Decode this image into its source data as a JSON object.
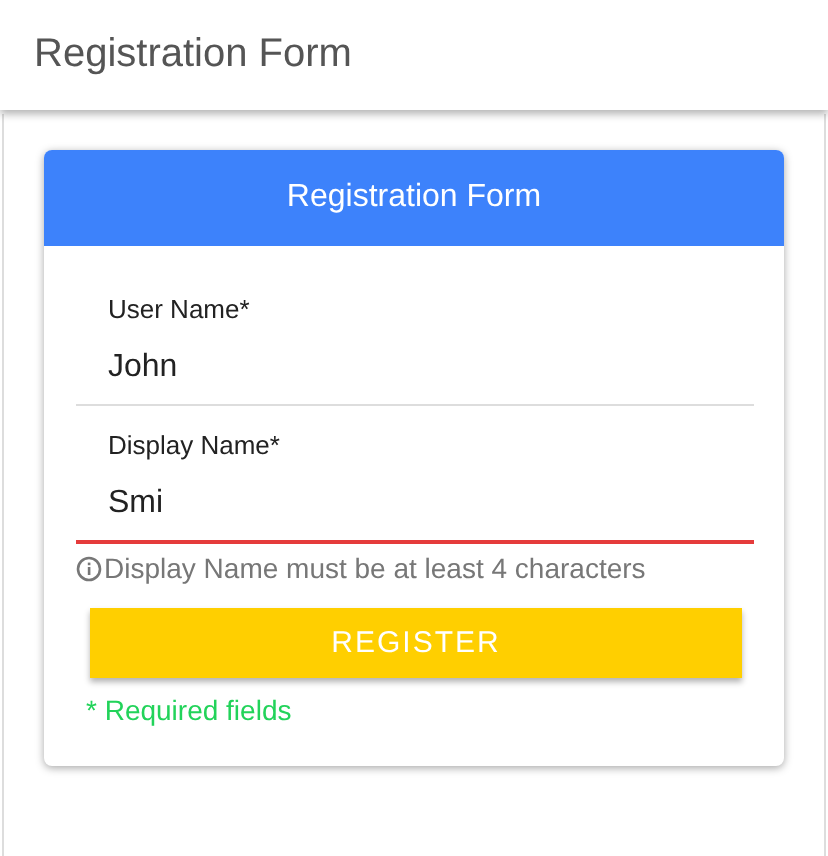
{
  "header": {
    "title": "Registration Form"
  },
  "card": {
    "title": "Registration Form",
    "fields": [
      {
        "label": "User Name*",
        "value": "John",
        "invalid": false
      },
      {
        "label": "Display Name*",
        "value": "Smi",
        "invalid": true,
        "error": "Display Name must be at least 4 characters"
      }
    ],
    "button": "REGISTER",
    "note": "* Required fields"
  }
}
